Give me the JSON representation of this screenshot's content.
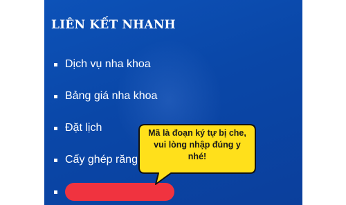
{
  "section": {
    "heading": "LIÊN KẾT NHANH"
  },
  "links": [
    {
      "label": "Dịch vụ nha khoa"
    },
    {
      "label": "Bảng giá nha khoa"
    },
    {
      "label": "Đặt lịch"
    },
    {
      "label": "Cấy ghép răng Im"
    }
  ],
  "callout": {
    "text": "Mã là đoạn ký tự bị che, vui lòng nhập đúng y nhé!"
  },
  "colors": {
    "panel_bg": "#0a47a8",
    "redaction": "#f0333f",
    "callout_bg": "#ffe01b"
  }
}
